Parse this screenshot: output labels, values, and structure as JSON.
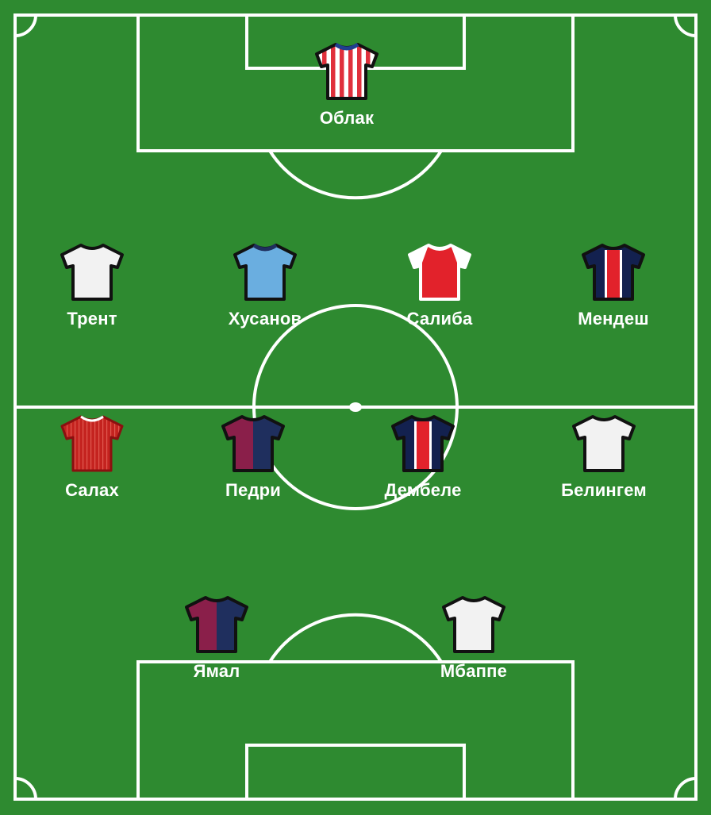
{
  "formation": {
    "goalkeeper": {
      "name": "Облак",
      "kit": "stripes-red-white"
    },
    "defenders": [
      {
        "name": "Трент",
        "kit": "white"
      },
      {
        "name": "Хусанов",
        "kit": "sky-blue"
      },
      {
        "name": "Салиба",
        "kit": "red-white-sleeves"
      },
      {
        "name": "Мендеш",
        "kit": "navy-red-stripe"
      }
    ],
    "midfielders": [
      {
        "name": "Салах",
        "kit": "red-pinstripe"
      },
      {
        "name": "Педри",
        "kit": "blaugrana"
      },
      {
        "name": "Дембеле",
        "kit": "navy-red-stripe"
      },
      {
        "name": "Белингем",
        "kit": "white"
      }
    ],
    "forwards": [
      {
        "name": "Ямал",
        "kit": "blaugrana"
      },
      {
        "name": "Мбаппе",
        "kit": "white"
      }
    ]
  },
  "colors": {
    "pitch": "#2e8a30",
    "lines": "#ffffff",
    "kit_outline": "#111111"
  }
}
